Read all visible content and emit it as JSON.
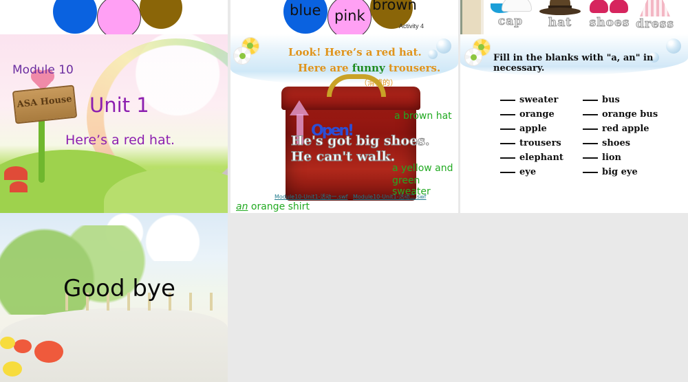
{
  "app": {
    "background_color": "#e9e9e9",
    "slide_gap_color": "#e9e9e9"
  },
  "slides": [
    {
      "id": "slide-colours-plain",
      "row": 1,
      "col": 1,
      "circles": [
        {
          "label": "",
          "color": "#0a62e0",
          "name": "blue-circle"
        },
        {
          "label": "",
          "color": "#ffa0f4",
          "name": "pink-circle"
        },
        {
          "label": "",
          "color": "#8a6508",
          "name": "brown-circle"
        }
      ]
    },
    {
      "id": "slide-colours-labelled",
      "row": 1,
      "col": 2,
      "activity_label": "Activity 4",
      "circles": [
        {
          "label": "blue",
          "color": "#0a62e0",
          "name": "blue-circle"
        },
        {
          "label": "pink",
          "color": "#ffa0f4",
          "name": "pink-circle"
        },
        {
          "label": "brown",
          "color": "#8a6508",
          "name": "brown-circle"
        }
      ]
    },
    {
      "id": "slide-vocabulary-clothes",
      "row": 1,
      "col": 3,
      "words": [
        {
          "label": "cap",
          "icon": "cap-icon"
        },
        {
          "label": "hat",
          "icon": "hat-icon"
        },
        {
          "label": "shoes",
          "icon": "shoes-icon"
        },
        {
          "label": "dress",
          "icon": "dress-icon"
        }
      ]
    },
    {
      "id": "slide-title",
      "row": 2,
      "col": 1,
      "module": "Module 10",
      "unit": "Unit 1",
      "subtitle": "Here’s a red hat.",
      "sign_text": "ASA House",
      "title_color": "#8c1fb0",
      "module_color": "#6b2ea0"
    },
    {
      "id": "slide-look-here",
      "row": 2,
      "col": 2,
      "line1": "Look! Here’s a red hat.",
      "line2_a": "Here are ",
      "line2_b": "funny",
      "line2_c": " trousers.",
      "chinese_note": "（滑稽的）",
      "open_word": "Open!",
      "overlay1": "He's got big shoes.",
      "overlay2": "He can't walk.",
      "callout_brown_hat": "a brown hat",
      "callout_orange_shirt_article": "an",
      "callout_orange_shirt_rest": " orange shirt",
      "callout_sweater_line1": "a yellow and",
      "callout_sweater_line2": "green sweater",
      "link1": "Module10-Unit1-活动一.swf",
      "link2": "Module10-Unit1-活动二.swf",
      "heading_color": "#e0941c",
      "accent_green": "#1e8b1e",
      "callout_color": "#22aa22",
      "link_color": "#1f7a8c"
    },
    {
      "id": "slide-fill-blanks",
      "row": 2,
      "col": 3,
      "title": "Fill in the blanks with \"a, an\" in necessary.",
      "items": [
        "sweater",
        "bus",
        "orange",
        "orange bus",
        "apple",
        "red apple",
        "trousers",
        "shoes",
        "elephant",
        "lion",
        "eye",
        "big eye"
      ]
    },
    {
      "id": "slide-goodbye",
      "row": 3,
      "col": 1,
      "text": "Good bye"
    }
  ]
}
